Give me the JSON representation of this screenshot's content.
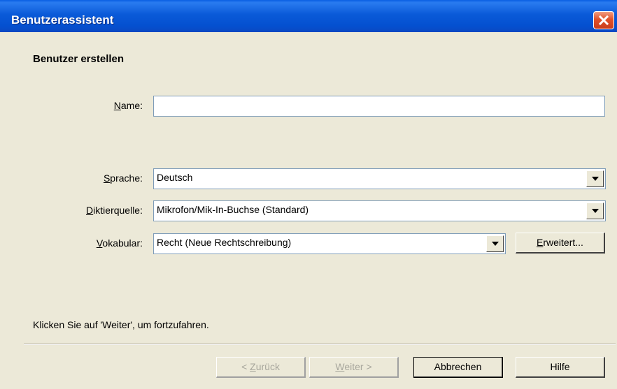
{
  "window": {
    "title": "Benutzerassistent"
  },
  "page": {
    "heading": "Benutzer erstellen",
    "hint": "Klicken Sie auf 'Weiter', um fortzufahren."
  },
  "form": {
    "name": {
      "label_mnemonic": "N",
      "label_rest": "ame:",
      "value": ""
    },
    "sprache": {
      "label_mnemonic": "S",
      "label_rest": "prache:",
      "value": "Deutsch"
    },
    "diktierquelle": {
      "label_mnemonic": "D",
      "label_rest": "iktierquelle:",
      "value": "Mikrofon/Mik-In-Buchse (Standard)"
    },
    "vokabular": {
      "label_mnemonic": "V",
      "label_rest": "okabular:",
      "value": "Recht (Neue Rechtschreibung)"
    }
  },
  "buttons": {
    "erweitert": {
      "mnemonic": "E",
      "rest": "rweitert..."
    },
    "zurueck": {
      "prefix": "< ",
      "mnemonic": "Z",
      "rest": "urück"
    },
    "weiter": {
      "mnemonic": "W",
      "rest": "eiter >"
    },
    "abbrechen": {
      "label": "Abbrechen"
    },
    "hilfe": {
      "label": "Hilfe"
    }
  },
  "colors": {
    "titlebar": "#0a5ad8",
    "dialog_bg": "#ece9d8",
    "close": "#e0512a"
  },
  "icons": {
    "close": "close-icon",
    "dropdown": "chevron-down-icon"
  }
}
